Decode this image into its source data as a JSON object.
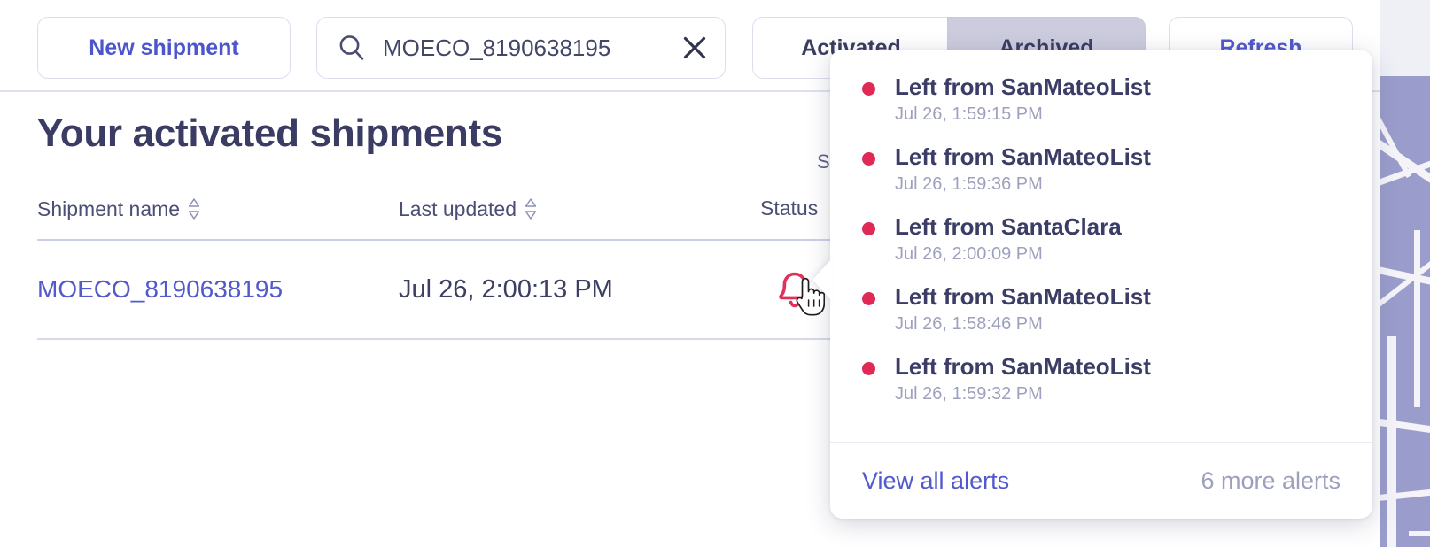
{
  "toolbar": {
    "new_shipment_label": "New shipment",
    "search": {
      "value": "MOECO_8190638195",
      "placeholder": "Search shipments",
      "search_icon": "search-icon",
      "clear_icon": "close-icon"
    },
    "tabs": [
      {
        "label": "Activated",
        "selected": false
      },
      {
        "label": "Archived",
        "selected": true
      }
    ],
    "refresh_label": "Refresh"
  },
  "page": {
    "title": "Your activated shipments",
    "showing_label": "Sh"
  },
  "table": {
    "columns": [
      {
        "label": "Shipment name",
        "sortable": true
      },
      {
        "label": "Last updated",
        "sortable": true
      },
      {
        "label": "Status",
        "sortable": false
      }
    ],
    "rows": [
      {
        "shipment_name": "MOECO_8190638195",
        "last_updated": "Jul 26, 2:00:13 PM",
        "status_icon": "bell-icon"
      }
    ]
  },
  "alerts_dropdown": {
    "items": [
      {
        "title": "Left from SanMateoList",
        "time": "Jul 26, 1:59:15 PM"
      },
      {
        "title": "Left from SanMateoList",
        "time": "Jul 26, 1:59:36 PM"
      },
      {
        "title": "Left from SantaClara",
        "time": "Jul 26, 2:00:09 PM"
      },
      {
        "title": "Left from SanMateoList",
        "time": "Jul 26, 1:58:46 PM"
      },
      {
        "title": "Left from SanMateoList",
        "time": "Jul 26, 1:59:32 PM"
      }
    ],
    "view_all_label": "View all alerts",
    "more_count_label": "6 more alerts"
  },
  "colors": {
    "accent_indigo": "#5159cc",
    "alert_red": "#e02a55",
    "text_navy": "#3b3d66",
    "muted": "#9ea1bd",
    "tab_selected_bg": "#ccccde",
    "border": "#dcdef0",
    "map_land": "#9a9ccb"
  }
}
